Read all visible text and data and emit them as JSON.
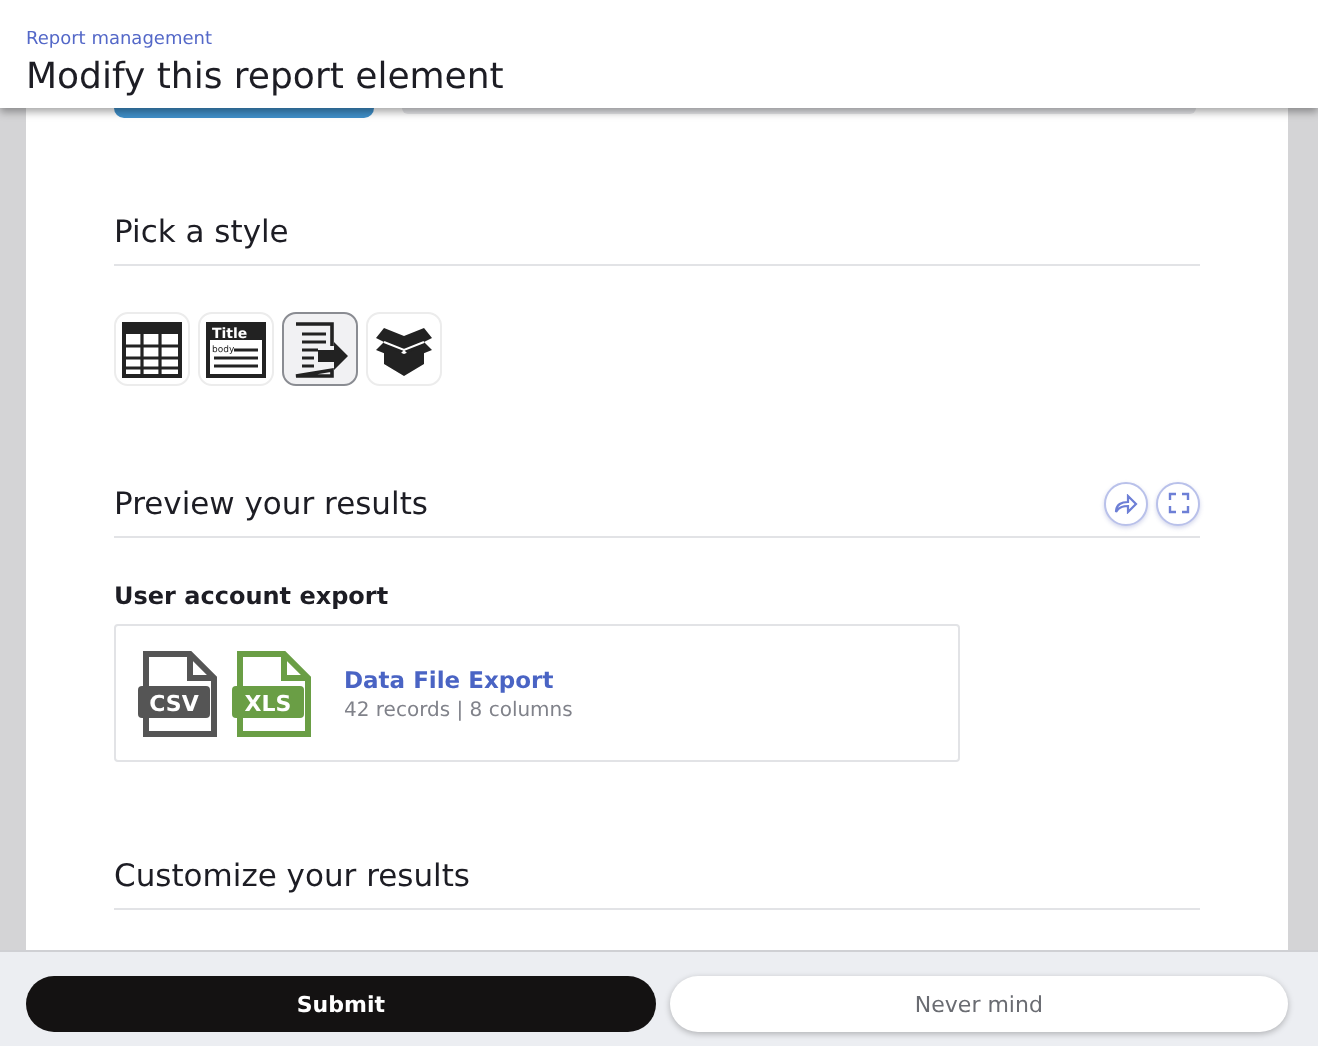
{
  "header": {
    "breadcrumb": "Report management",
    "title": "Modify this report element"
  },
  "sections": [
    {
      "title": "Pick a style",
      "styles": [
        {
          "kind": "grid",
          "selected": false
        },
        {
          "kind": "titled",
          "selected": false,
          "title": "Title",
          "body": "body"
        },
        {
          "kind": "export",
          "selected": true
        },
        {
          "kind": "box",
          "selected": false
        }
      ]
    },
    {
      "title": "Preview your results",
      "actions": [
        {
          "kind": "share"
        },
        {
          "kind": "fullscreen"
        }
      ],
      "preview": {
        "label": "User account export",
        "file": {
          "formats": [
            "CSV",
            "XLS"
          ],
          "name": "Data File Export",
          "details": "42 records | 8 columns"
        }
      }
    },
    {
      "title": "Customize your results"
    }
  ],
  "footer": {
    "buttons": [
      {
        "label": "Submit",
        "kind": "primary"
      },
      {
        "label": "Never mind",
        "kind": "secondary"
      }
    ]
  }
}
